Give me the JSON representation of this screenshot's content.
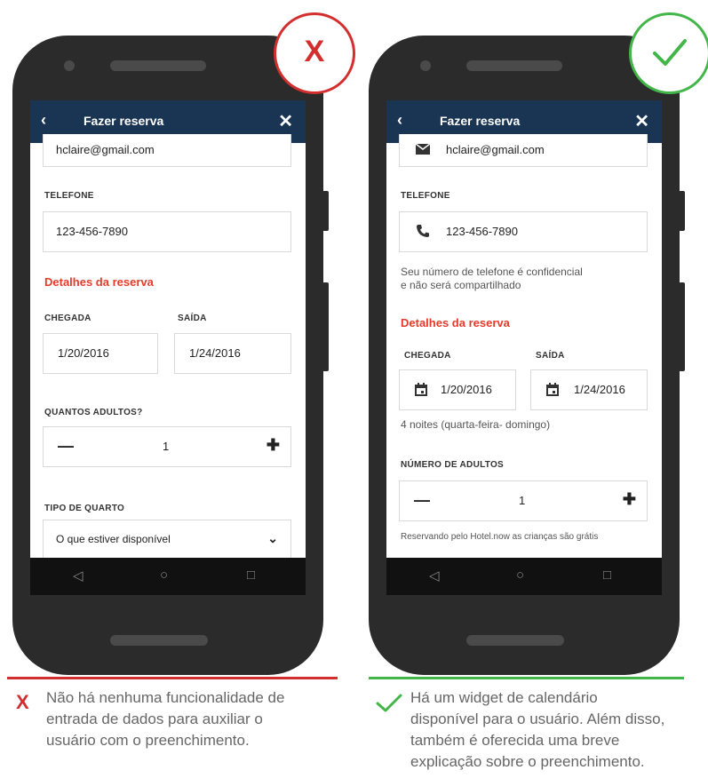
{
  "left": {
    "app_bar": {
      "title": "Fazer reserva"
    },
    "email_value": "hclaire@gmail.com",
    "phone_label": "TELEFONE",
    "phone_value": "123-456-7890",
    "section_title": "Detalhes da reserva",
    "checkin_label": "CHEGADA",
    "checkout_label": "SAÍDA",
    "checkin_value": "1/20/2016",
    "checkout_value": "1/24/2016",
    "adults_label": "QUANTOS ADULTOS?",
    "adults_value": "1",
    "room_label": "TIPO DE QUARTO",
    "room_value": "O que estiver disponível",
    "badge_symbol": "X",
    "caption": [
      "Não há nenhuma funcionalidade de",
      "entrada de dados para auxiliar o",
      "usuário com o preenchimento."
    ]
  },
  "right": {
    "app_bar": {
      "title": "Fazer reserva"
    },
    "email_value": "hclaire@gmail.com",
    "phone_label": "TELEFONE",
    "phone_value": "123-456-7890",
    "phone_note": [
      "Seu número de telefone é confidencial",
      "e não será compartilhado"
    ],
    "section_title": "Detalhes da reserva",
    "checkin_label": "CHEGADA",
    "checkout_label": "SAÍDA",
    "checkin_value": "1/20/2016",
    "checkout_value": "1/24/2016",
    "nights_note": "4 noites (quarta-feira- domingo)",
    "adults_label": "NÚMERO DE ADULTOS",
    "adults_value": "1",
    "children_note": "Reservando pelo Hotel.now as crianças são grátis",
    "caption": [
      "Há um widget de calendário",
      "disponível para o usuário. Além disso,",
      "também é oferecida uma breve",
      "explicação sobre o preenchimento."
    ]
  },
  "icons": {
    "back": "back-arrow-icon",
    "close": "close-icon",
    "minus": "minus-icon",
    "plus": "plus-icon",
    "dropdown": "chevron-down-icon",
    "mail": "mail-icon",
    "phone": "phone-icon",
    "calendar": "calendar-icon",
    "checkmark": "checkmark-icon",
    "nav_back": "nav-back-icon",
    "nav_home": "nav-home-icon",
    "nav_recents": "nav-recents-icon"
  },
  "colors": {
    "app_bar": "#1a3554",
    "accent_red": "#e63a2b",
    "bad": "#d32f2f",
    "good": "#43b649",
    "phone_body": "#2b2b2b"
  }
}
